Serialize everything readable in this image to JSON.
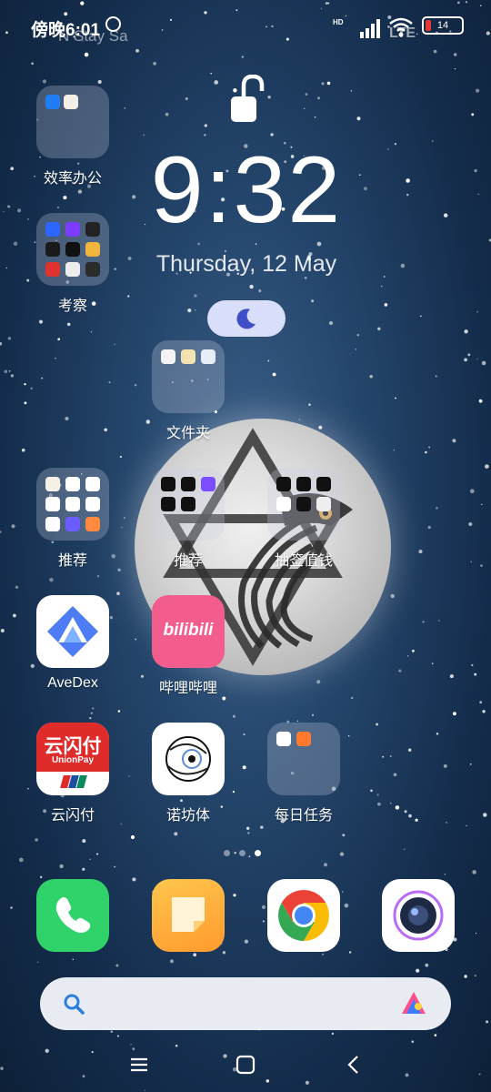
{
  "status_bar": {
    "time": "傍晚6:01",
    "ghost_text": "N Stay Sa",
    "network_badge": "HD",
    "network_type": "LTE",
    "battery_level": "14",
    "battery_color": "#e53935"
  },
  "lockscreen": {
    "clock": "9:32",
    "date": "Thursday, 12 May"
  },
  "folders": {
    "efficiency": {
      "label": "效率办公"
    },
    "inspect": {
      "label": "考察"
    },
    "files": {
      "label": "文件夹"
    },
    "recommend1": {
      "label": "推荐"
    },
    "recommend2": {
      "label": "推荐"
    },
    "lottery": {
      "label": "抽签值钱"
    },
    "daily": {
      "label": "每日任务"
    }
  },
  "apps": {
    "avedex": {
      "label": "AveDex"
    },
    "bilibili": {
      "label": "哔哩哔哩",
      "logo_text": "bilibili"
    },
    "unionpay": {
      "label": "云闪付",
      "logo_cn": "云闪付",
      "logo_en": "UnionPay"
    },
    "nuofang": {
      "label": "诺坊体"
    }
  },
  "dock": [
    "phone-icon",
    "notes-icon",
    "chrome-icon",
    "camera-icon"
  ],
  "pager": {
    "pages": 3,
    "active": 3
  },
  "accent_colors": {
    "search_bg": "#e8ebf1",
    "dnd_bg": "#d9dffb",
    "moon_icon": "#3f4ec8"
  }
}
